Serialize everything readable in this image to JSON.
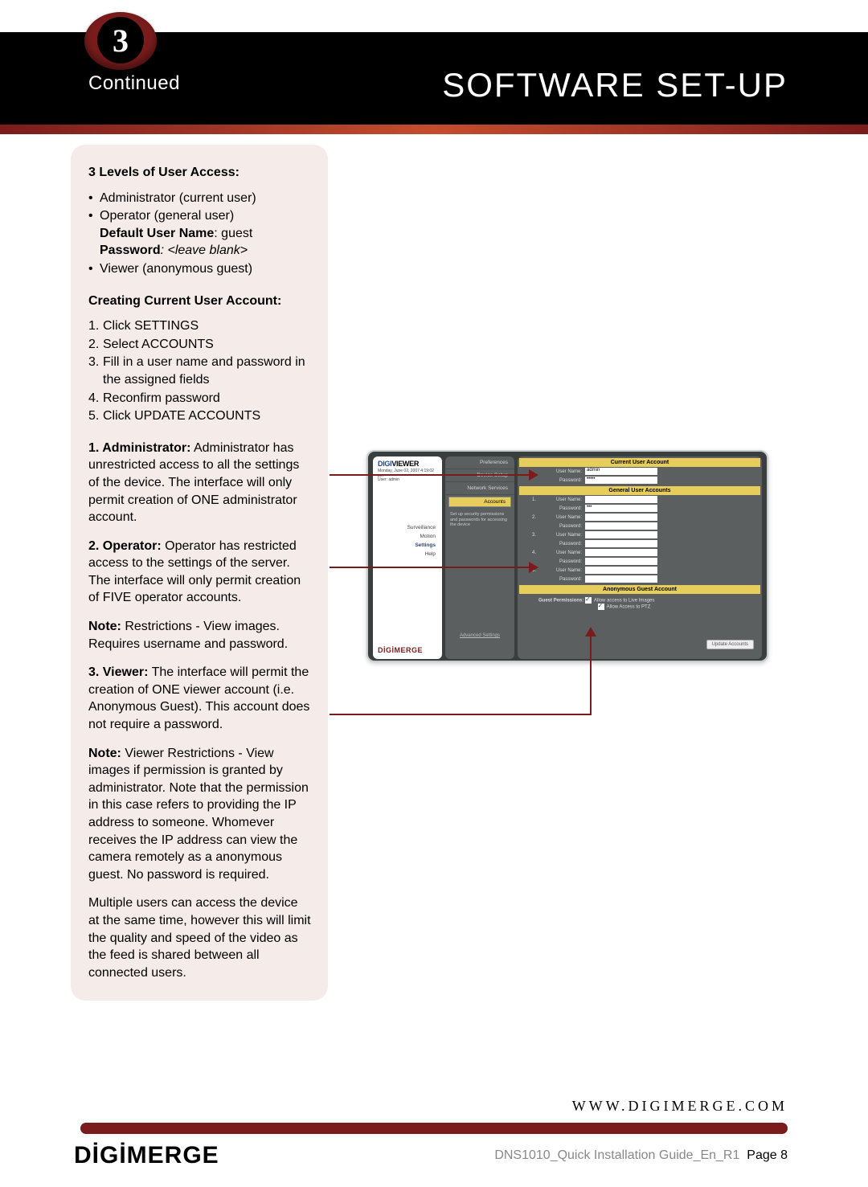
{
  "header": {
    "step_number": "3",
    "continued": "Continued",
    "title": "SOFTWARE SET-UP"
  },
  "sidebar": {
    "heading1": "3 Levels of User Access:",
    "levels": {
      "admin": "Administrator (current user)",
      "operator": "Operator (general user)",
      "default_user_label": "Default User Name",
      "default_user_value": ": guest",
      "password_label": "Password",
      "password_value": ": <leave blank>",
      "viewer": "Viewer (anonymous guest)"
    },
    "heading2": "Creating Current User Account:",
    "steps": {
      "s1": "Click SETTINGS",
      "s2": "Select ACCOUNTS",
      "s3": "Fill in a user name and password in the assigned fields",
      "s4": "Reconfirm password",
      "s5": "Click UPDATE ACCOUNTS"
    },
    "para_admin_label": "1. Administrator:",
    "para_admin": " Administrator has unrestricted access to all the settings of the device. The interface will only permit creation of ONE administrator account.",
    "para_op_label": "2. Operator:",
    "para_op": " Operator has restricted access to the settings of the server. The interface will only permit creation of FIVE operator accounts.",
    "note1_label": "Note:",
    "note1": " Restrictions - View images. Requires username and password.",
    "para_viewer_label": "3. Viewer:",
    "para_viewer": " The interface will permit the creation of ONE viewer account (i.e. Anonymous Guest). This account does not require a password.",
    "note2_label": "Note:",
    "note2": " Viewer Restrictions - View images if permission is granted by administrator. Note that the permission in this case refers to providing the IP address to someone. Whomever receives the IP address can view the camera remotely as a anonymous guest. No password is required.",
    "para_multi": "Multiple users can access the device at the same time, however this will limit the quality and speed of the video as the feed is shared between all connected users."
  },
  "screenshot": {
    "digiviewer": "DIGI",
    "digiviewer2": "VIEWER",
    "meta1": "Monday, June 02, 2007 4:19:02",
    "meta2": "pm",
    "meta3": "User: admin",
    "nav": {
      "surveillance": "Surveillance",
      "motion": "Motion",
      "settings": "Settings",
      "help": "Help"
    },
    "digimerge": "DİGİMERGE",
    "mid": {
      "preferences": "Preferences",
      "device_setup": "Device Setup",
      "network_services": "Network Services",
      "accounts": "Accounts",
      "desc": "Set up security permissions and passwords for accessing the device",
      "advanced": "Advanced Settings"
    },
    "right": {
      "bar1": "Current User Account",
      "bar2": "General User Accounts",
      "bar3": "Anonymous Guest Account",
      "username_label": "User Name:",
      "password_label": "Password:",
      "admin_value": "admin",
      "pw_mask": "•••••",
      "pw_mask2": "•••",
      "perm_label": "Guest Permissions:",
      "perm1": "Allow access to Live Images",
      "perm2": "Allow Access to PTZ",
      "update_btn": "Update Accounts"
    }
  },
  "footer": {
    "website": "WWW.DIGIMERGE.COM",
    "logo": "DİGİMERGE",
    "docid": "DNS1010_Quick Installation Guide_En_R1",
    "page_label": "Page 8"
  }
}
